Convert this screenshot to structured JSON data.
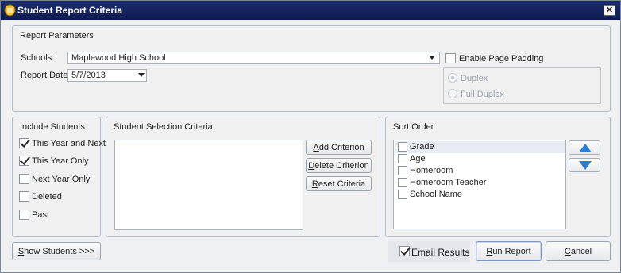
{
  "window": {
    "title": "Student Report Criteria",
    "close_glyph": "✕"
  },
  "report_parameters": {
    "title": "Report Parameters",
    "schools_label": "Schools:",
    "schools_value": "Maplewood High School",
    "report_date_label": "Report Date:",
    "report_date_value": "5/7/2013",
    "enable_page_padding_label": "Enable Page Padding",
    "enable_page_padding_checked": false,
    "duplex_label": "Duplex",
    "full_duplex_label": "Full Duplex",
    "duplex_selected": "Duplex"
  },
  "include_students": {
    "title": "Include Students",
    "items": [
      {
        "label": "This Year and Next",
        "checked": true
      },
      {
        "label": "This Year Only",
        "checked": true
      },
      {
        "label": "Next Year Only",
        "checked": false
      },
      {
        "label": "Deleted",
        "checked": false
      },
      {
        "label": "Past",
        "checked": false
      }
    ]
  },
  "selection_criteria": {
    "title": "Student Selection Criteria",
    "add_label": "Add Criterion",
    "delete_label": "Delete Criterion",
    "reset_label": "Reset Criteria"
  },
  "sort_order": {
    "title": "Sort Order",
    "items": [
      {
        "label": "Grade",
        "checked": false
      },
      {
        "label": "Age",
        "checked": false
      },
      {
        "label": "Homeroom",
        "checked": false
      },
      {
        "label": "Homeroom Teacher",
        "checked": false
      },
      {
        "label": "School Name",
        "checked": false
      }
    ],
    "up_icon": "arrow-up-icon",
    "down_icon": "arrow-down-icon"
  },
  "footer": {
    "show_students_label": "Show Students >>>",
    "email_results_label": "Email Results",
    "email_results_checked": true,
    "run_report_label": "Run Report",
    "cancel_label": "Cancel"
  },
  "colors": {
    "titlebar": "#12225e",
    "arrow_blue": "#2a7fd4",
    "window_bg": "#eff0f2"
  }
}
